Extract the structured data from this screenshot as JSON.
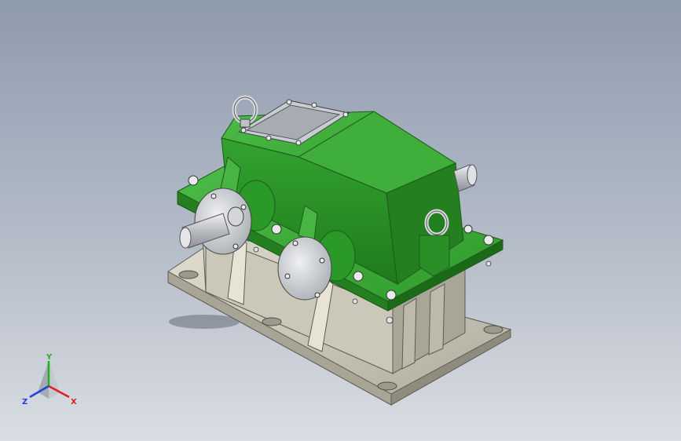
{
  "viewport": {
    "background_top": "#8e9aad",
    "background_bottom": "#dadde3"
  },
  "model": {
    "icon": "gearbox-3d-model",
    "housing_color": "#2f9a2c",
    "housing_highlight": "#5fc85a",
    "base_color": "#c9c6b7",
    "metal_color": "#cfd2d6"
  },
  "triad": {
    "x_label": "X",
    "y_label": "Y",
    "z_label": "Z",
    "x_color": "#e02020",
    "y_color": "#20b020",
    "z_color": "#2040e0"
  }
}
